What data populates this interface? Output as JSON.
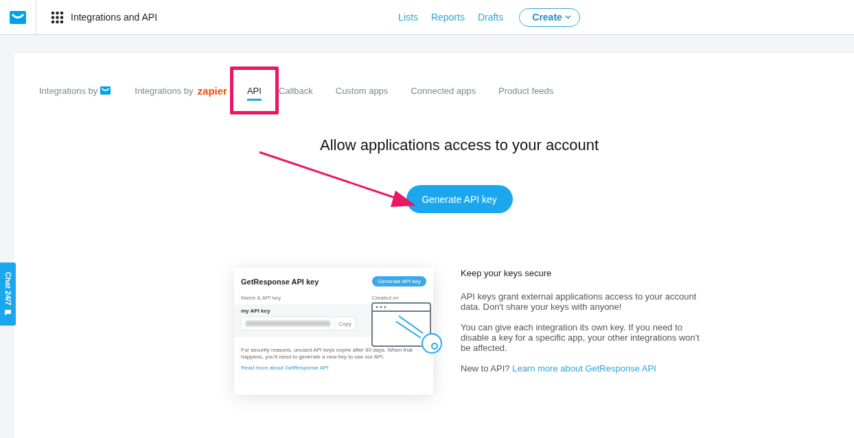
{
  "header": {
    "title": "Integrations and API",
    "nav": [
      "Lists",
      "Reports",
      "Drafts"
    ],
    "create_button": "Create"
  },
  "tabs": [
    {
      "kind": "mail-logo",
      "label": "Integrations by",
      "selected": false
    },
    {
      "kind": "text-logo",
      "label": "Integrations by",
      "logo_text": "zapier",
      "selected": false
    },
    {
      "kind": "plain",
      "label": "API",
      "selected": true,
      "highlighted": true
    },
    {
      "kind": "plain",
      "label": "Callback",
      "selected": false
    },
    {
      "kind": "plain",
      "label": "Custom apps",
      "selected": false
    },
    {
      "kind": "plain",
      "label": "Connected apps",
      "selected": false
    },
    {
      "kind": "plain",
      "label": "Product feeds",
      "selected": false
    }
  ],
  "heading": "Allow applications access to your account",
  "generate_button": "Generate API key",
  "illustration": {
    "title": "GetResponse API key",
    "button": "Generate API key",
    "column_1": "Name & API key",
    "column_2": "Created on",
    "key_name": "my API key",
    "copy": "Copy",
    "note": "For security reasons, unused API keys expire after 90 days. When that happens, you'll need to generate a new key to use our API.",
    "link": "Read more about GetResponse API"
  },
  "info": {
    "title": "Keep your keys secure",
    "paragraphs": [
      "API keys grant external applications access to your account data. Don't share your keys with anyone!",
      "You can give each integration its own key. If you need to disable a key for a specific app, your other integrations won't be affected."
    ],
    "footer_text": "New to API?",
    "footer_link": "Learn more about GetResponse API"
  },
  "chat_tab": "Chat 24/7"
}
